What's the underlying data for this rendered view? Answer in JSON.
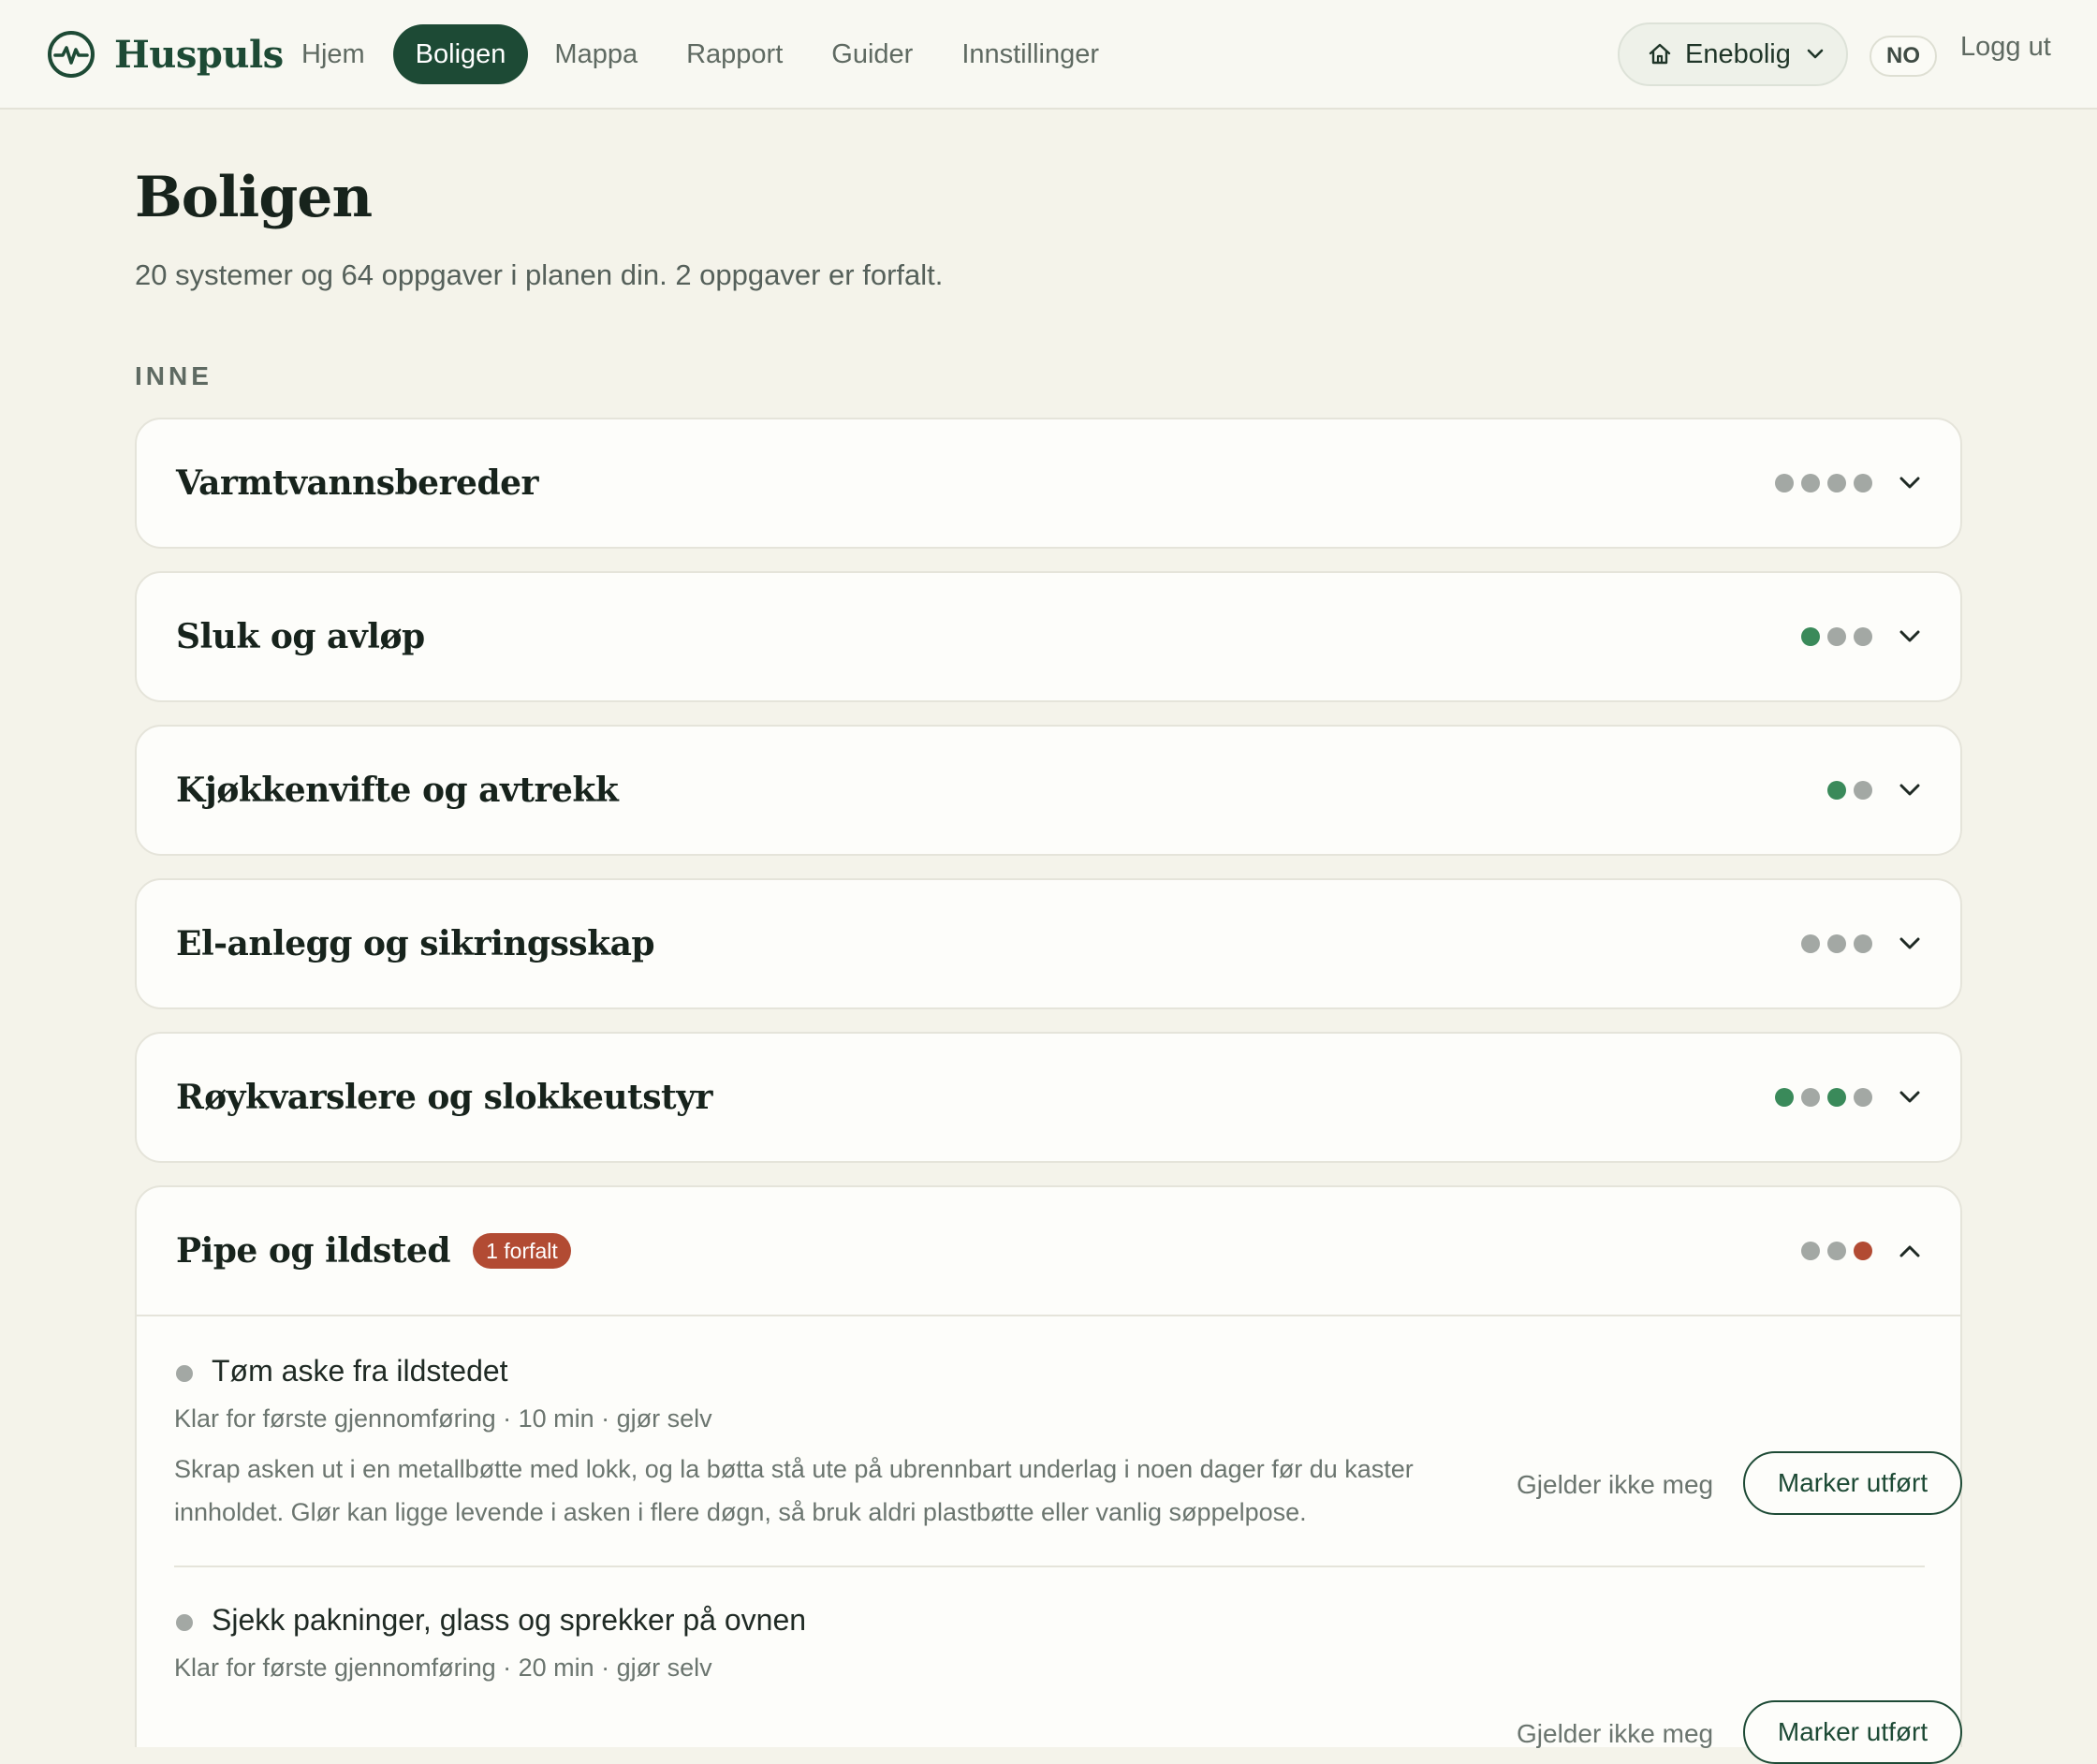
{
  "brand": {
    "name": "Huspuls",
    "logo_icon": "pulse-circle-icon",
    "color": "#1d4a35"
  },
  "nav": {
    "items": [
      {
        "label": "Hjem",
        "active": false
      },
      {
        "label": "Boligen",
        "active": true
      },
      {
        "label": "Mappa",
        "active": false
      },
      {
        "label": "Rapport",
        "active": false
      },
      {
        "label": "Guider",
        "active": false
      },
      {
        "label": "Innstillinger",
        "active": false
      }
    ],
    "home_selector": {
      "label": "Enebolig",
      "icon": "house-icon"
    },
    "language": "NO",
    "logout": "Logg ut"
  },
  "page": {
    "title": "Boligen",
    "summary": "20 systemer og 64 oppgaver i planen din. 2 oppgaver er forfalt.",
    "section_label": "INNE"
  },
  "systems": [
    {
      "title": "Varmtvannsbereder",
      "status_dots": [
        "grey",
        "grey",
        "grey",
        "grey"
      ],
      "expanded": false
    },
    {
      "title": "Sluk og avløp",
      "status_dots": [
        "green",
        "grey",
        "grey"
      ],
      "expanded": false
    },
    {
      "title": "Kjøkkenvifte og avtrekk",
      "status_dots": [
        "green",
        "grey"
      ],
      "expanded": false
    },
    {
      "title": "El-anlegg og sikringsskap",
      "status_dots": [
        "grey",
        "grey",
        "grey"
      ],
      "expanded": false
    },
    {
      "title": "Røykvarslere og slokkeutstyr",
      "status_dots": [
        "green",
        "grey",
        "green",
        "grey"
      ],
      "expanded": false
    },
    {
      "title": "Pipe og ildsted",
      "badge": "1 forfalt",
      "status_dots": [
        "grey",
        "grey",
        "red"
      ],
      "expanded": true
    }
  ],
  "tasks": [
    {
      "title": "Tøm aske fra ildstedet",
      "meta": "Klar for første gjennomføring · 10 min · gjør selv",
      "description": "Skrap asken ut i en metallbøtte med lokk, og la bøtta stå ute på ubrennbart underlag i noen dager før du kaster innholdet. Glør kan ligge levende i asken i flere døgn, så bruk aldri plastbøtte eller vanlig søppelpose.",
      "skip_label": "Gjelder ikke meg",
      "done_label": "Marker utført"
    },
    {
      "title": "Sjekk pakninger, glass og sprekker på ovnen",
      "meta": "Klar for første gjennomføring · 20 min · gjør selv",
      "skip_label": "Gjelder ikke meg",
      "done_label": "Marker utført"
    }
  ],
  "colors": {
    "accent": "#1d4a35",
    "ok": "#3a8a5a",
    "overdue": "#b24b33",
    "neutral": "#a3a8a4",
    "background": "#f4f3ea"
  }
}
